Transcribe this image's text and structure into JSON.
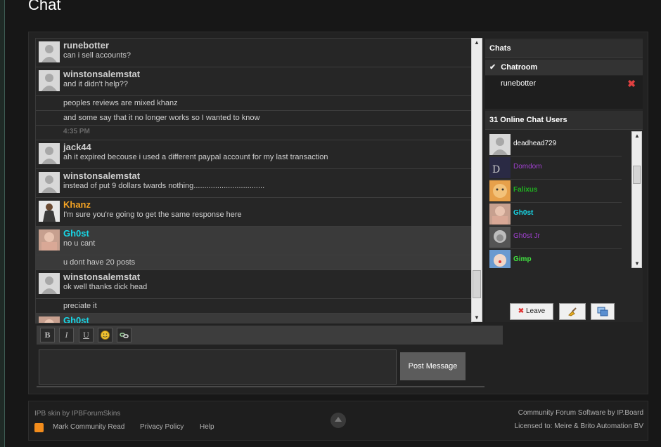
{
  "page": {
    "title": "Chat"
  },
  "messages": [
    {
      "kind": "msg",
      "user": "runebotter",
      "text": "can i sell accounts?",
      "color": "#cfcfcf",
      "avatar": "default"
    },
    {
      "kind": "msg",
      "user": "winstonsalemstat",
      "text": "and it didn't help??",
      "color": "#cfcfcf",
      "avatar": "default"
    },
    {
      "kind": "cont",
      "text": "peoples reviews are mixed khanz"
    },
    {
      "kind": "cont",
      "text": "and some say that it no longer works so I wanted to know"
    },
    {
      "kind": "time",
      "text": "4:35 PM"
    },
    {
      "kind": "msg",
      "user": "jack44",
      "text": "ah it expired becouse i used a different paypal account for my last transaction",
      "color": "#cfcfcf",
      "avatar": "default"
    },
    {
      "kind": "msg",
      "user": "winstonsalemstat",
      "text": "instead of put 9 dollars twards nothing.................................",
      "color": "#cfcfcf",
      "avatar": "default"
    },
    {
      "kind": "msg",
      "user": "Khanz",
      "text": "I'm sure you're going to get the same response here",
      "color": "#f4a324",
      "avatar": "photo"
    },
    {
      "kind": "msg",
      "user": "Gh0st",
      "text": "no u cant",
      "color": "#18d6e6",
      "avatar": "pink",
      "highlight": true
    },
    {
      "kind": "cont",
      "text": "u dont have 20 posts",
      "highlight": true
    },
    {
      "kind": "msg",
      "user": "winstonsalemstat",
      "text": "ok well thanks dick head",
      "color": "#cfcfcf",
      "avatar": "default"
    },
    {
      "kind": "cont",
      "text": "preciate it"
    },
    {
      "kind": "msg",
      "user": "Gh0st",
      "text": "",
      "color": "#18d6e6",
      "avatar": "pink",
      "highlight": true
    }
  ],
  "editor": {
    "tools": [
      {
        "label": "B",
        "icon": "bold-icon"
      },
      {
        "label": "I",
        "icon": "italic-icon"
      },
      {
        "label": "U",
        "icon": "underline-icon"
      },
      {
        "label": "",
        "icon": "smiley-icon"
      },
      {
        "label": "",
        "icon": "link-icon"
      }
    ],
    "post_label": "Post Message"
  },
  "side": {
    "chats_title": "Chats",
    "chatroom_label": "Chatroom",
    "private_chat": "runebotter",
    "online_title": "31 Online Chat Users",
    "users": [
      {
        "name": "deadhead729",
        "color": "#ffffff",
        "avatar": "default",
        "bold": false
      },
      {
        "name": "Domdom",
        "color": "#a040d0",
        "avatar": "dark",
        "bold": false
      },
      {
        "name": "Falixus",
        "color": "#20b020",
        "avatar": "tiger",
        "bold": true
      },
      {
        "name": "Gh0st",
        "color": "#18d6e6",
        "avatar": "pink",
        "bold": true
      },
      {
        "name": "Gh0st Jr",
        "color": "#a040d0",
        "avatar": "einstein",
        "bold": false
      },
      {
        "name": "Gimp",
        "color": "#40e040",
        "avatar": "clown",
        "bold": true
      }
    ],
    "leave_label": "Leave"
  },
  "footer": {
    "skin_credit": "IPB skin by IPBForumSkins",
    "mark_read": "Mark Community Read",
    "privacy": "Privacy Policy",
    "help": "Help",
    "software": "Community Forum Software by IP.Board",
    "license": "Licensed to: Meire & Brito Automation BV"
  }
}
